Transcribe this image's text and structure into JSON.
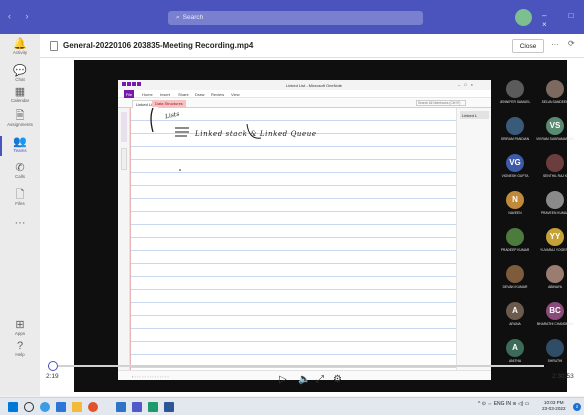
{
  "titlebar": {
    "nav_arrows": "‹ ›",
    "search_placeholder": "Search",
    "window_controls": "– □ ×"
  },
  "rail": [
    {
      "icon": "bell-icon",
      "glyph": "🔔",
      "label": "Activity"
    },
    {
      "icon": "chat-icon",
      "glyph": "💬",
      "label": "Chat"
    },
    {
      "icon": "calendar-icon",
      "glyph": "▦",
      "label": "Calendar"
    },
    {
      "icon": "assignments-icon",
      "glyph": "🗎",
      "label": "Assignments"
    },
    {
      "icon": "teams-icon",
      "glyph": "👥",
      "label": "Teams",
      "active": true
    },
    {
      "icon": "calls-icon",
      "glyph": "✆",
      "label": "Calls"
    },
    {
      "icon": "files-icon",
      "glyph": "🗋",
      "label": "Files"
    },
    {
      "icon": "more-icon",
      "glyph": "···",
      "label": ""
    },
    {
      "icon": "apps-icon",
      "glyph": "⊞",
      "label": "Apps"
    },
    {
      "icon": "help-icon",
      "glyph": "?",
      "label": "Help"
    }
  ],
  "header": {
    "file_title": "General-20220106 203835-Meeting Recording.mp4",
    "close_label": "Close",
    "more_glyph": "···",
    "share_glyph": "⟳"
  },
  "onenote": {
    "window_title": "Linked List - Microsoft OneNote",
    "file_tab": "File",
    "ribbon_tabs": [
      "Home",
      "Insert",
      "Share",
      "Draw",
      "Review",
      "View"
    ],
    "notebook_tab": "Linked List",
    "section_tab": "Data Structures",
    "search_placeholder": "Search All Notebooks (Ctrl+E)",
    "page_tab": "Linked L",
    "handwriting_left": "Lists",
    "handwriting_text": "Linked stack & Linked Queue"
  },
  "participants": [
    {
      "initials": "",
      "name": "JENNIFER SAMUEL",
      "color": "#5b5b5b"
    },
    {
      "initials": "",
      "name": "SELVA SANDEEP",
      "color": "#7c6a60"
    },
    {
      "initials": "",
      "name": "SRIRAM PANDIAN",
      "color": "#3a5a7a"
    },
    {
      "initials": "VS",
      "name": "VIKRAM SUBRAMANIAN",
      "color": "#5a8a72"
    },
    {
      "initials": "VG",
      "name": "VIGNESH GUPTA",
      "color": "#3d5aa8"
    },
    {
      "initials": "",
      "name": "SENTHIL RAJ K",
      "color": "#6b3d3d"
    },
    {
      "initials": "N",
      "name": "NAVEEN",
      "color": "#c08a3a"
    },
    {
      "initials": "",
      "name": "PRAVEEN KUMAR",
      "color": "#8a8a8a"
    },
    {
      "initials": "",
      "name": "PRADEEP KUMAR",
      "color": "#4d7a3d"
    },
    {
      "initials": "YY",
      "name": "YUVARAJ YOGESH",
      "color": "#c4a237"
    },
    {
      "initials": "",
      "name": "DEVAKI KUMAR",
      "color": "#7d5b3b"
    },
    {
      "initials": "",
      "name": "ABINAYA",
      "color": "#9a7d70"
    },
    {
      "initials": "A",
      "name": "ARUNA",
      "color": "#6b5a4d"
    },
    {
      "initials": "BC",
      "name": "BHARATHI CHANDRAN",
      "color": "#8a4a7a"
    },
    {
      "initials": "A",
      "name": "ANITHA",
      "color": "#3d6b5a"
    },
    {
      "initials": "",
      "name": "SHRUTHI",
      "color": "#2f4d66"
    }
  ],
  "player": {
    "elapsed": "2:19",
    "total": "2:30:53",
    "progress_fraction": 0.01
  },
  "taskbar": {
    "tray_text": "^ ⊙ ⇔ ENG IN ≋ ◁) ▭",
    "time": "10:03 PM",
    "date": "23-03-2022",
    "notification_count": "2"
  }
}
